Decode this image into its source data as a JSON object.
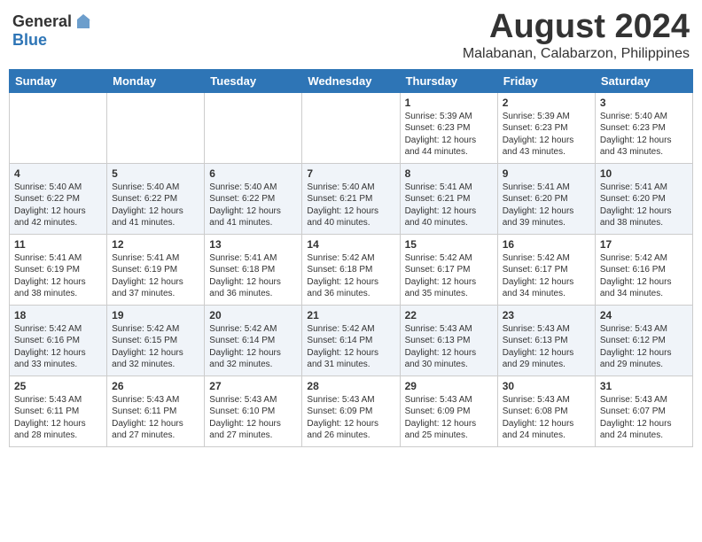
{
  "logo": {
    "general": "General",
    "blue": "Blue"
  },
  "title": "August 2024",
  "location": "Malabanan, Calabarzon, Philippines",
  "days": [
    "Sunday",
    "Monday",
    "Tuesday",
    "Wednesday",
    "Thursday",
    "Friday",
    "Saturday"
  ],
  "weeks": [
    [
      {
        "day": "",
        "data": ""
      },
      {
        "day": "",
        "data": ""
      },
      {
        "day": "",
        "data": ""
      },
      {
        "day": "",
        "data": ""
      },
      {
        "day": "1",
        "data": "Sunrise: 5:39 AM\nSunset: 6:23 PM\nDaylight: 12 hours\nand 44 minutes."
      },
      {
        "day": "2",
        "data": "Sunrise: 5:39 AM\nSunset: 6:23 PM\nDaylight: 12 hours\nand 43 minutes."
      },
      {
        "day": "3",
        "data": "Sunrise: 5:40 AM\nSunset: 6:23 PM\nDaylight: 12 hours\nand 43 minutes."
      }
    ],
    [
      {
        "day": "4",
        "data": "Sunrise: 5:40 AM\nSunset: 6:22 PM\nDaylight: 12 hours\nand 42 minutes."
      },
      {
        "day": "5",
        "data": "Sunrise: 5:40 AM\nSunset: 6:22 PM\nDaylight: 12 hours\nand 41 minutes."
      },
      {
        "day": "6",
        "data": "Sunrise: 5:40 AM\nSunset: 6:22 PM\nDaylight: 12 hours\nand 41 minutes."
      },
      {
        "day": "7",
        "data": "Sunrise: 5:40 AM\nSunset: 6:21 PM\nDaylight: 12 hours\nand 40 minutes."
      },
      {
        "day": "8",
        "data": "Sunrise: 5:41 AM\nSunset: 6:21 PM\nDaylight: 12 hours\nand 40 minutes."
      },
      {
        "day": "9",
        "data": "Sunrise: 5:41 AM\nSunset: 6:20 PM\nDaylight: 12 hours\nand 39 minutes."
      },
      {
        "day": "10",
        "data": "Sunrise: 5:41 AM\nSunset: 6:20 PM\nDaylight: 12 hours\nand 38 minutes."
      }
    ],
    [
      {
        "day": "11",
        "data": "Sunrise: 5:41 AM\nSunset: 6:19 PM\nDaylight: 12 hours\nand 38 minutes."
      },
      {
        "day": "12",
        "data": "Sunrise: 5:41 AM\nSunset: 6:19 PM\nDaylight: 12 hours\nand 37 minutes."
      },
      {
        "day": "13",
        "data": "Sunrise: 5:41 AM\nSunset: 6:18 PM\nDaylight: 12 hours\nand 36 minutes."
      },
      {
        "day": "14",
        "data": "Sunrise: 5:42 AM\nSunset: 6:18 PM\nDaylight: 12 hours\nand 36 minutes."
      },
      {
        "day": "15",
        "data": "Sunrise: 5:42 AM\nSunset: 6:17 PM\nDaylight: 12 hours\nand 35 minutes."
      },
      {
        "day": "16",
        "data": "Sunrise: 5:42 AM\nSunset: 6:17 PM\nDaylight: 12 hours\nand 34 minutes."
      },
      {
        "day": "17",
        "data": "Sunrise: 5:42 AM\nSunset: 6:16 PM\nDaylight: 12 hours\nand 34 minutes."
      }
    ],
    [
      {
        "day": "18",
        "data": "Sunrise: 5:42 AM\nSunset: 6:16 PM\nDaylight: 12 hours\nand 33 minutes."
      },
      {
        "day": "19",
        "data": "Sunrise: 5:42 AM\nSunset: 6:15 PM\nDaylight: 12 hours\nand 32 minutes."
      },
      {
        "day": "20",
        "data": "Sunrise: 5:42 AM\nSunset: 6:14 PM\nDaylight: 12 hours\nand 32 minutes."
      },
      {
        "day": "21",
        "data": "Sunrise: 5:42 AM\nSunset: 6:14 PM\nDaylight: 12 hours\nand 31 minutes."
      },
      {
        "day": "22",
        "data": "Sunrise: 5:43 AM\nSunset: 6:13 PM\nDaylight: 12 hours\nand 30 minutes."
      },
      {
        "day": "23",
        "data": "Sunrise: 5:43 AM\nSunset: 6:13 PM\nDaylight: 12 hours\nand 29 minutes."
      },
      {
        "day": "24",
        "data": "Sunrise: 5:43 AM\nSunset: 6:12 PM\nDaylight: 12 hours\nand 29 minutes."
      }
    ],
    [
      {
        "day": "25",
        "data": "Sunrise: 5:43 AM\nSunset: 6:11 PM\nDaylight: 12 hours\nand 28 minutes."
      },
      {
        "day": "26",
        "data": "Sunrise: 5:43 AM\nSunset: 6:11 PM\nDaylight: 12 hours\nand 27 minutes."
      },
      {
        "day": "27",
        "data": "Sunrise: 5:43 AM\nSunset: 6:10 PM\nDaylight: 12 hours\nand 27 minutes."
      },
      {
        "day": "28",
        "data": "Sunrise: 5:43 AM\nSunset: 6:09 PM\nDaylight: 12 hours\nand 26 minutes."
      },
      {
        "day": "29",
        "data": "Sunrise: 5:43 AM\nSunset: 6:09 PM\nDaylight: 12 hours\nand 25 minutes."
      },
      {
        "day": "30",
        "data": "Sunrise: 5:43 AM\nSunset: 6:08 PM\nDaylight: 12 hours\nand 24 minutes."
      },
      {
        "day": "31",
        "data": "Sunrise: 5:43 AM\nSunset: 6:07 PM\nDaylight: 12 hours\nand 24 minutes."
      }
    ]
  ]
}
